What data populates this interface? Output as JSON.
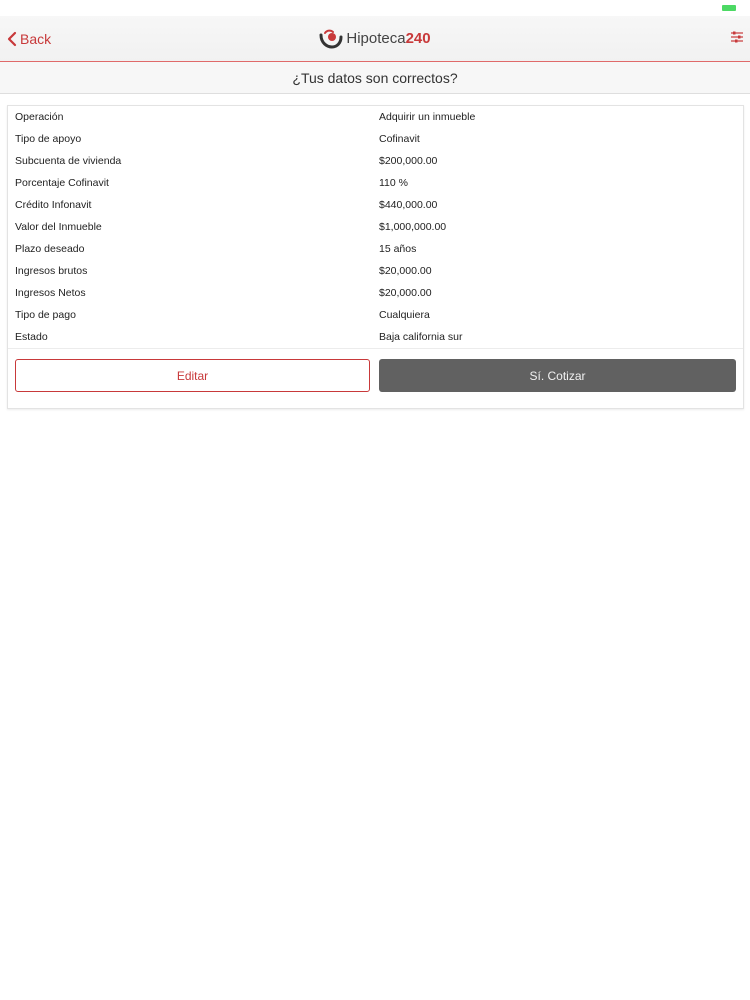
{
  "header": {
    "back_label": "Back",
    "brand_left": "Hipoteca",
    "brand_right": "240",
    "accent_color": "#c8393a"
  },
  "subheader": {
    "title": "¿Tus datos son correctos?"
  },
  "details": [
    {
      "label": "Operación",
      "value": "Adquirir un inmueble"
    },
    {
      "label": "Tipo de apoyo",
      "value": "Cofinavit"
    },
    {
      "label": "Subcuenta de vivienda",
      "value": "$200,000.00"
    },
    {
      "label": "Porcentaje Cofinavit",
      "value": "110 %"
    },
    {
      "label": "Crédito Infonavit",
      "value": "$440,000.00"
    },
    {
      "label": "Valor del Inmueble",
      "value": "$1,000,000.00"
    },
    {
      "label": "Plazo deseado",
      "value": "15 años"
    },
    {
      "label": "Ingresos brutos",
      "value": "$20,000.00"
    },
    {
      "label": "Ingresos Netos",
      "value": "$20,000.00"
    },
    {
      "label": "Tipo de pago",
      "value": "Cualquiera"
    },
    {
      "label": "Estado",
      "value": "Baja california sur"
    }
  ],
  "actions": {
    "edit_label": "Editar",
    "quote_label": "Sí. Cotizar"
  }
}
